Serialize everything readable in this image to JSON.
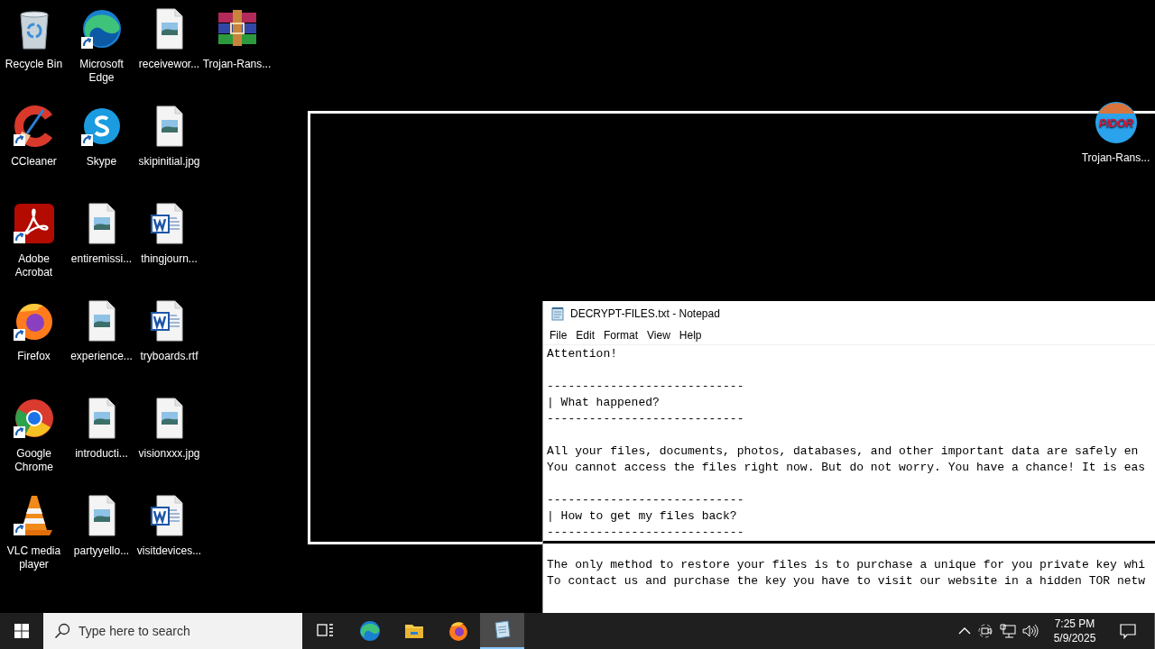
{
  "desktop": {
    "columns": [
      [
        {
          "label": "Recycle Bin",
          "kind": "recycle",
          "shortcut": false
        },
        {
          "label": "CCleaner",
          "kind": "ccleaner",
          "shortcut": true
        },
        {
          "label": "Adobe Acrobat",
          "kind": "acrobat",
          "shortcut": true
        },
        {
          "label": "Firefox",
          "kind": "firefox",
          "shortcut": true
        },
        {
          "label": "Google Chrome",
          "kind": "chrome",
          "shortcut": true
        },
        {
          "label": "VLC media player",
          "kind": "vlc",
          "shortcut": true
        }
      ],
      [
        {
          "label": "Microsoft Edge",
          "kind": "edge",
          "shortcut": true
        },
        {
          "label": "Skype",
          "kind": "skype",
          "shortcut": true
        },
        {
          "label": "entiremissi...",
          "kind": "image",
          "shortcut": false
        },
        {
          "label": "experience...",
          "kind": "image",
          "shortcut": false
        },
        {
          "label": "introducti...",
          "kind": "image",
          "shortcut": false
        },
        {
          "label": "partyyello...",
          "kind": "image",
          "shortcut": false
        }
      ],
      [
        {
          "label": "receivewor...",
          "kind": "image",
          "shortcut": false
        },
        {
          "label": "skipinitial.jpg",
          "kind": "image",
          "shortcut": false
        },
        {
          "label": "thingjourn...",
          "kind": "word",
          "shortcut": false
        },
        {
          "label": "tryboards.rtf",
          "kind": "word",
          "shortcut": false
        },
        {
          "label": "visionxxx.jpg",
          "kind": "image",
          "shortcut": false
        },
        {
          "label": "visitdevices...",
          "kind": "word",
          "shortcut": false
        }
      ],
      [
        {
          "label": "Trojan-Rans...",
          "kind": "winrar",
          "shortcut": false
        }
      ]
    ],
    "corner_icon": {
      "label": "Trojan-Rans...",
      "kind": "ransom",
      "logo_text": "PIDOR"
    }
  },
  "notepad": {
    "title": "DECRYPT-FILES.txt - Notepad",
    "menu": [
      "File",
      "Edit",
      "Format",
      "View",
      "Help"
    ],
    "blocks": [
      [
        "Attention!"
      ],
      [
        "----------------------------",
        "| What happened?",
        "----------------------------"
      ],
      [
        "All your files, documents, photos, databases, and other important data are safely en",
        "You cannot access the files right now. But do not worry. You have a chance! It is eas"
      ],
      [
        "----------------------------",
        "| How to get my files back?",
        "----------------------------"
      ],
      [
        "The only method to restore your files is to purchase a unique for you private key whi",
        "To contact us and purchase the key you have to visit our website in a hidden TOR netw"
      ]
    ]
  },
  "taskbar": {
    "search": {
      "placeholder": "Type here to search"
    },
    "apps": [
      {
        "kind": "task_view",
        "selected": false
      },
      {
        "kind": "edge",
        "selected": false
      },
      {
        "kind": "explorer",
        "selected": false
      },
      {
        "kind": "firefox",
        "selected": false
      },
      {
        "kind": "notepad",
        "selected": true
      }
    ],
    "tray": [
      {
        "kind": "chevron"
      },
      {
        "kind": "meet"
      },
      {
        "kind": "network"
      },
      {
        "kind": "volume"
      }
    ],
    "time": "7:25 PM",
    "date": "5/9/2025"
  }
}
